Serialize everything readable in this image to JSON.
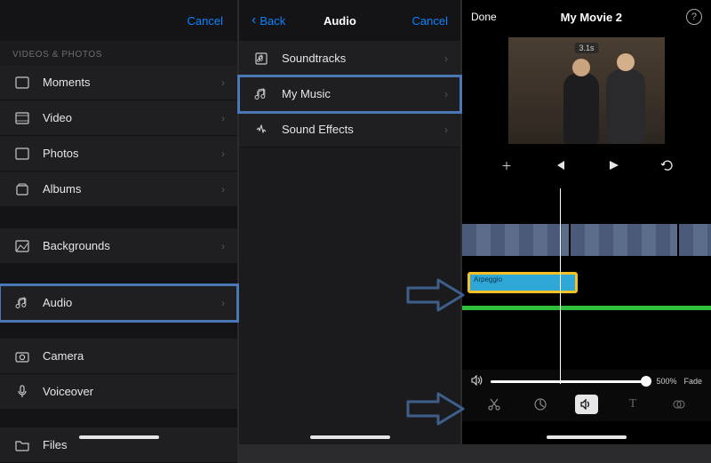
{
  "panel1": {
    "cancel": "Cancel",
    "section_header": "Videos & Photos",
    "items": [
      {
        "label": "Moments"
      },
      {
        "label": "Video"
      },
      {
        "label": "Photos"
      },
      {
        "label": "Albums"
      }
    ],
    "backgrounds_label": "Backgrounds",
    "audio_label": "Audio",
    "camera_label": "Camera",
    "voiceover_label": "Voiceover",
    "files_label": "Files"
  },
  "panel2": {
    "back": "Back",
    "title": "Audio",
    "cancel": "Cancel",
    "items": [
      {
        "label": "Soundtracks"
      },
      {
        "label": "My Music"
      },
      {
        "label": "Sound Effects"
      }
    ]
  },
  "panel3": {
    "done": "Done",
    "title": "My Movie 2",
    "help_glyph": "?",
    "preview_time": "3.1s",
    "audio_clip_label": "Arpeggio",
    "volume_value": "500%",
    "fade_label": "Fade"
  },
  "glyphs": {
    "chevron_right": "›",
    "chevron_left": "‹",
    "plus": "＋",
    "skip_back": "⏮",
    "play": "▶",
    "undo": "↺",
    "speaker": "🔊",
    "scissors": "✂",
    "speed": "◔",
    "text_tool": "T",
    "filter": "◑"
  }
}
